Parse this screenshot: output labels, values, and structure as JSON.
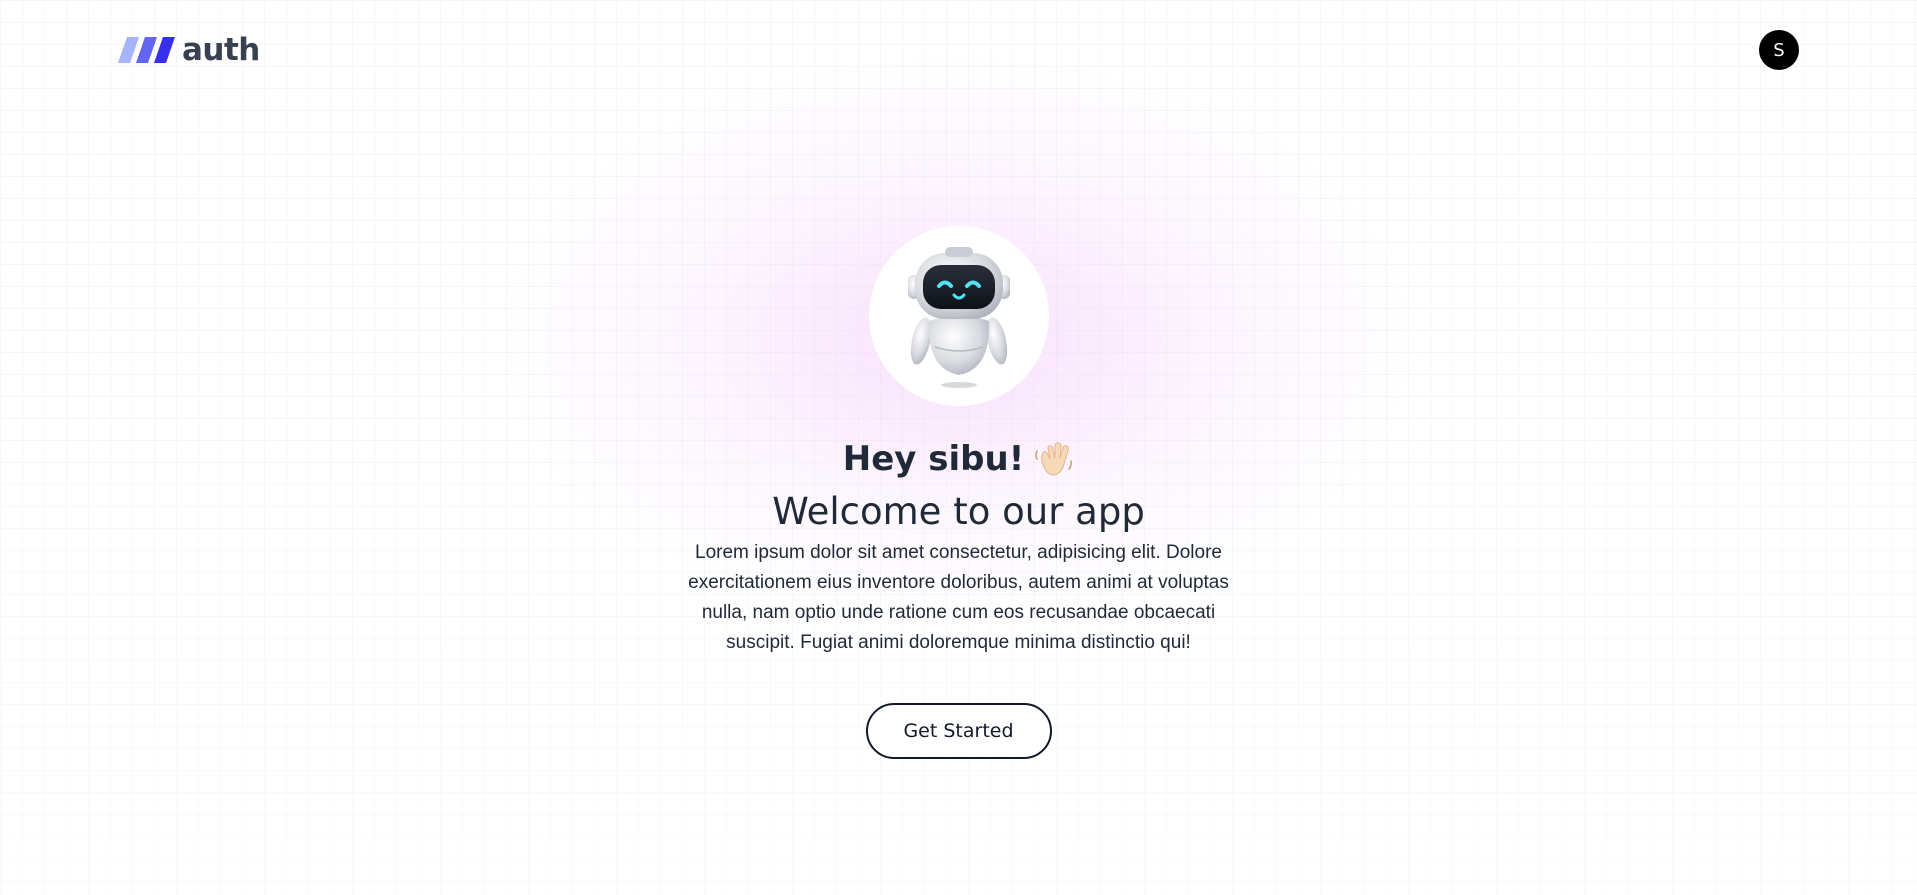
{
  "header": {
    "brand_name": "auth",
    "avatar_initial": "S"
  },
  "hero": {
    "greeting": "Hey sibu!",
    "title": "Welcome to our app",
    "description": "Lorem ipsum dolor sit amet consectetur, adipisicing elit. Dolore exercitationem eius inventore doloribus, autem animi at voluptas nulla, nam optio unde ratione cum eos recusandae obcaecati suscipit. Fugiat animi doloremque minima distinctio qui!",
    "cta_label": "Get Started"
  },
  "icons": {
    "brand": "slanted-bars-logo-icon",
    "robot": "robot-icon",
    "wave": "waving-hand-icon"
  },
  "colors": {
    "brand_mark": "#4f46e5",
    "avatar_bg": "#000000",
    "text": "#1f2937",
    "glow": "#f4c8fa"
  }
}
